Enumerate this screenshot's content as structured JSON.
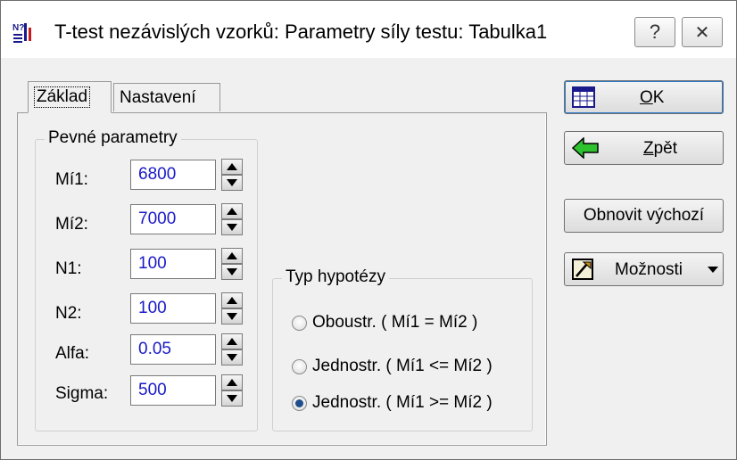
{
  "window": {
    "title": "T-test nezávislých vzorků: Parametry síly testu: Tabulka1",
    "help_label": "?",
    "close_label": "✕"
  },
  "tabs": [
    {
      "label": "Základ",
      "active": true
    },
    {
      "label": "Nastavení",
      "active": false
    }
  ],
  "fixed_params": {
    "legend": "Pevné parametry",
    "rows": [
      {
        "label": "Mí1:",
        "value": "6800"
      },
      {
        "label": "Mí2:",
        "value": "7000"
      },
      {
        "label": "N1:",
        "value": "100"
      },
      {
        "label": "N2:",
        "value": "100"
      },
      {
        "label": "Alfa:",
        "value": "0.05"
      },
      {
        "label": "Sigma:",
        "value": "500"
      }
    ]
  },
  "hypothesis": {
    "legend": "Typ hypotézy",
    "options": [
      {
        "label": "Oboustr. ( Mí1 = Mí2 )",
        "selected": false
      },
      {
        "label": "Jednostr. ( Mí1 <= Mí2 )",
        "selected": false
      },
      {
        "label": "Jednostr. ( Mí1 >= Mí2 )",
        "selected": true
      }
    ]
  },
  "buttons": {
    "ok_mnemonic": "O",
    "ok_rest": "K",
    "back_mnemonic": "Z",
    "back_rest": "pět",
    "reset_label": "Obnovit výchozí",
    "options_label": "Možnosti"
  },
  "icons": {
    "app": "statistica-app-icon",
    "ok": "spreadsheet-icon",
    "back": "green-left-arrow-icon",
    "options": "options-icon"
  },
  "colors": {
    "input_text": "#1a1ac8",
    "focus_ring": "#2a7ac9",
    "back_arrow": "#2fc22f"
  }
}
